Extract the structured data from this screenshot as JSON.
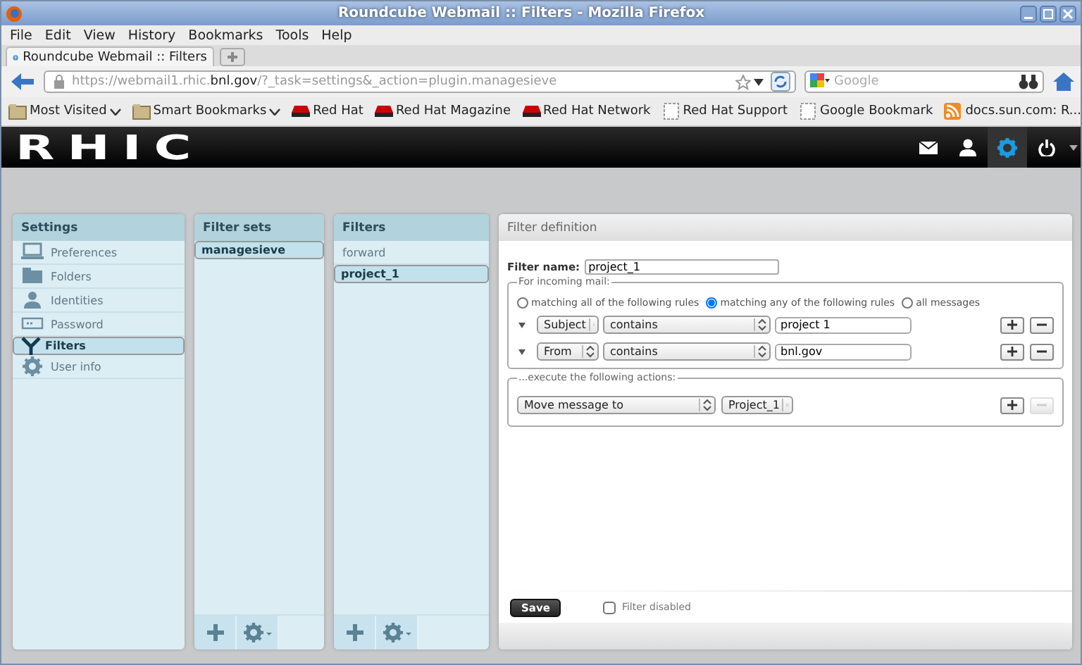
{
  "window": {
    "title": "Roundcube Webmail :: Filters - Mozilla Firefox"
  },
  "menu": [
    "File",
    "Edit",
    "View",
    "History",
    "Bookmarks",
    "Tools",
    "Help"
  ],
  "tabs": [
    {
      "label": "Roundcube Webmail :: Filters",
      "selected": true
    }
  ],
  "address": {
    "url": "https://webmail1.rhic.**bnl.gov**/?_task=settings&_action=plugin.managesieve"
  },
  "search": {
    "placeholder": "Google"
  },
  "bookmarks": [
    {
      "label": "Most Visited",
      "kind": "folder-menu"
    },
    {
      "label": "Smart Bookmarks",
      "kind": "folder-menu"
    },
    {
      "label": "Red Hat",
      "kind": "redhat"
    },
    {
      "label": "Red Hat Magazine",
      "kind": "redhat"
    },
    {
      "label": "Red Hat Network",
      "kind": "redhat"
    },
    {
      "label": "Red Hat Support",
      "kind": "page"
    },
    {
      "label": "Google Bookmark",
      "kind": "page"
    },
    {
      "label": "docs.sun.com: R...",
      "kind": "feed-menu"
    }
  ],
  "app": {
    "logo": "RHIC"
  },
  "settings": {
    "title": "Settings",
    "items": [
      {
        "label": "Preferences",
        "selected": false
      },
      {
        "label": "Folders",
        "selected": false
      },
      {
        "label": "Identities",
        "selected": false
      },
      {
        "label": "Password",
        "selected": false
      },
      {
        "label": "Filters",
        "selected": true
      },
      {
        "label": "User info",
        "selected": false
      }
    ]
  },
  "filter_sets": {
    "title": "Filter sets",
    "items": [
      {
        "label": "managesieve",
        "selected": true
      }
    ]
  },
  "filters": {
    "title": "Filters",
    "items": [
      {
        "label": "forward",
        "selected": false
      },
      {
        "label": "project_1",
        "selected": true
      }
    ]
  },
  "filter_definition": {
    "title": "Filter definition",
    "name_label": "Filter name:",
    "name_value": "project_1",
    "incoming": {
      "legend": "For incoming mail:",
      "match_options": [
        {
          "label": "matching all of the following rules",
          "selected": false
        },
        {
          "label": "matching any of the following rules",
          "selected": true
        },
        {
          "label": "all messages",
          "selected": false
        }
      ],
      "rules": [
        {
          "header": "Subject",
          "operator": "contains",
          "value": "project 1",
          "remove_disabled": false
        },
        {
          "header": "From",
          "operator": "contains",
          "value": "bnl.gov",
          "remove_disabled": false
        }
      ]
    },
    "actions": {
      "legend": "...execute the following actions:",
      "rows": [
        {
          "action": "Move message to",
          "target": "Project_1",
          "remove_disabled": true
        }
      ]
    },
    "save": "Save",
    "disabled_option": {
      "label": "Filter disabled",
      "checked": false
    }
  }
}
